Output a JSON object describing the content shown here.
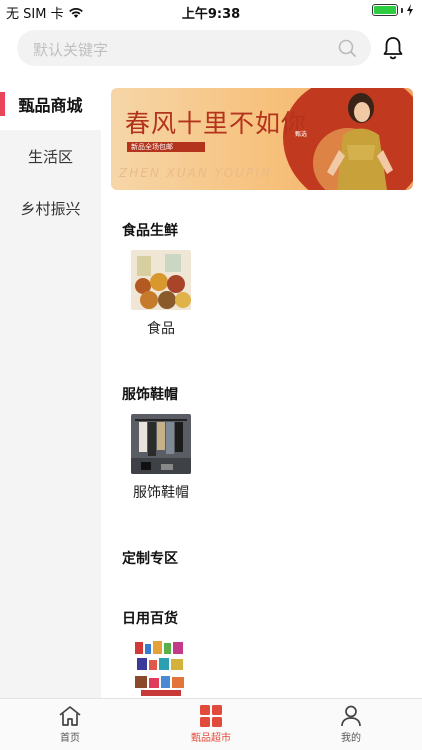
{
  "status_bar": {
    "carrier": "无 SIM 卡",
    "time": "上午9:38",
    "battery_level": 1.0
  },
  "search": {
    "placeholder": "默认关键字",
    "search_icon": "search-icon",
    "bell_icon": "bell-icon"
  },
  "sidebar": {
    "items": [
      {
        "label": "甄品商城",
        "active": true
      },
      {
        "label": "生活区",
        "active": false
      },
      {
        "label": "乡村振兴",
        "active": false
      }
    ]
  },
  "banner": {
    "title": "春风十里不如你",
    "tag": "新品全场包邮",
    "subtitle": "ZHEN XUAN YOUPIN",
    "badge": "甄选"
  },
  "sections": [
    {
      "title": "食品生鲜",
      "products": [
        {
          "label": "食品",
          "image": "food-assortment"
        }
      ]
    },
    {
      "title": "服饰鞋帽",
      "products": [
        {
          "label": "服饰鞋帽",
          "image": "clothing-rack"
        }
      ]
    },
    {
      "title": "定制专区",
      "products": []
    },
    {
      "title": "日用百货",
      "products": [
        {
          "label": "",
          "image": "daily-goods-collage"
        }
      ]
    }
  ],
  "tabbar": {
    "tabs": [
      {
        "label": "首页",
        "icon": "home-icon",
        "active": false
      },
      {
        "label": "甄品超市",
        "icon": "grid-icon",
        "active": true
      },
      {
        "label": "我的",
        "icon": "user-icon",
        "active": false
      }
    ],
    "active_color": "#e24b3b"
  },
  "colors": {
    "accent": "#e8445a",
    "banner_red": "#b3331c"
  }
}
